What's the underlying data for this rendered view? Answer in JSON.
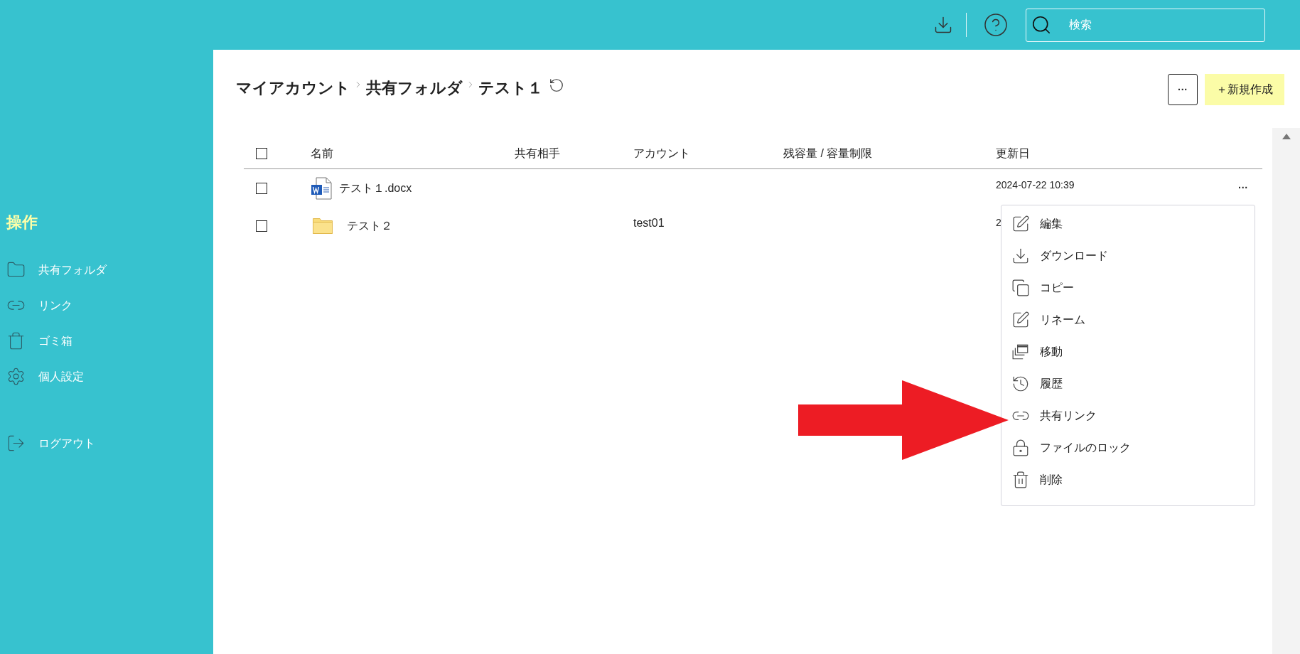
{
  "top_bar": {
    "search": {
      "placeholder": "検索"
    }
  },
  "sidebar": {
    "heading": "操作",
    "items": [
      {
        "label": "共有フォルダ"
      },
      {
        "label": "リンク"
      },
      {
        "label": "ゴミ箱"
      },
      {
        "label": "個人設定"
      }
    ],
    "logout": "ログアウト"
  },
  "breadcrumb": [
    "マイアカウント",
    "共有フォルダ",
    "テスト１"
  ],
  "actions": {
    "more": "···",
    "new": "＋新規作成"
  },
  "table": {
    "select_all": {
      "checked": false
    },
    "columns": [
      "名前",
      "共有相手",
      "アカウント",
      "残容量 / 容量制限",
      "更新日"
    ],
    "rows": [
      {
        "kind": "file",
        "checked": false,
        "name": "テスト１.docx",
        "shared_with": "",
        "account": "",
        "quota": "",
        "updated": "2024-07-22 10:39",
        "more": "···"
      },
      {
        "kind": "folder",
        "checked": false,
        "name": "テスト２",
        "shared_with": "",
        "account": "test01",
        "quota": "",
        "updated": "2",
        "more": ""
      }
    ]
  },
  "context_menu": {
    "items": [
      "編集",
      "ダウンロード",
      "コピー",
      "リネーム",
      "移動",
      "履歴",
      "共有リンク",
      "ファイルのロック",
      "削除"
    ]
  }
}
